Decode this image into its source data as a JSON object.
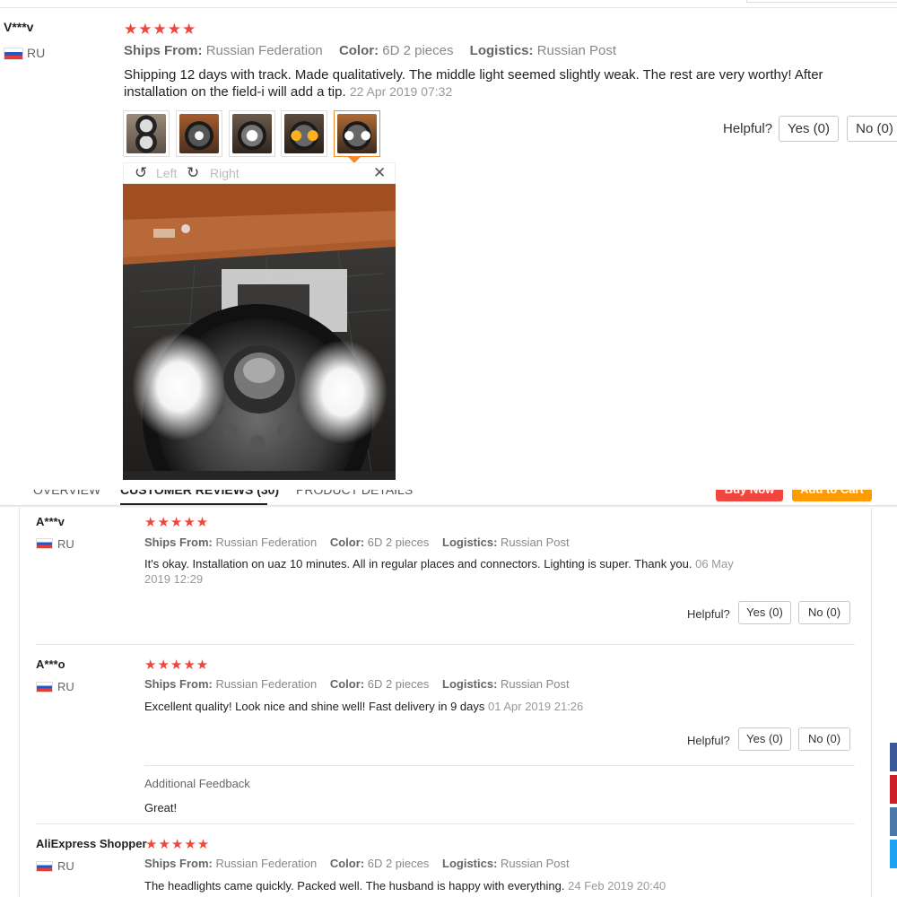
{
  "top_review": {
    "user": "V***v",
    "country": "RU",
    "stars": "★★★★★",
    "ships_from_label": "Ships From:",
    "ships_from": "Russian Federation",
    "color_label": "Color:",
    "color": "6D 2 pieces",
    "logistics_label": "Logistics:",
    "logistics": "Russian Post",
    "text": "Shipping 12 days with track. Made qualitatively. The middle light seemed slightly weak. The rest are very worthy! After installation on the field-i will add a tip.",
    "date": "22 Apr 2019 07:32",
    "helpful_label": "Helpful?",
    "yes_label": "Yes (0)",
    "no_label": "No (0)",
    "thumbnails": [
      "thumbnail-1",
      "thumbnail-2",
      "thumbnail-3",
      "thumbnail-4",
      "thumbnail-5"
    ],
    "selected_thumbnail": 5,
    "viewer": {
      "rotate_left_icon": "↺",
      "rotate_left_label": "Left",
      "rotate_right_icon": "↻",
      "rotate_right_label": "Right",
      "close_icon": "✕"
    }
  },
  "tabs": {
    "overview": "Overview",
    "reviews": "Customer Reviews (30)",
    "details": "Product Details",
    "buy_now": "Buy Now",
    "add_to_cart": "Add to Cart"
  },
  "reviews": [
    {
      "user": "A***v",
      "country": "RU",
      "stars": "★★★★★",
      "ships_from_label": "Ships From:",
      "ships_from": "Russian Federation",
      "color_label": "Color:",
      "color": "6D 2 pieces",
      "logistics_label": "Logistics:",
      "logistics": "Russian Post",
      "text": "It's okay. Installation on uaz 10 minutes. All in regular places and connectors. Lighting is super. Thank you.",
      "date": "06 May 2019 12:29",
      "helpful_label": "Helpful?",
      "yes_label": "Yes (0)",
      "no_label": "No (0)"
    },
    {
      "user": "A***o",
      "country": "RU",
      "stars": "★★★★★",
      "ships_from_label": "Ships From:",
      "ships_from": "Russian Federation",
      "color_label": "Color:",
      "color": "6D 2 pieces",
      "logistics_label": "Logistics:",
      "logistics": "Russian Post",
      "text": "Excellent quality! Look nice and shine well! Fast delivery in 9 days",
      "date": "01 Apr 2019 21:26",
      "helpful_label": "Helpful?",
      "yes_label": "Yes (0)",
      "no_label": "No (0)",
      "additional_feedback_label": "Additional Feedback",
      "additional_feedback": "Great!"
    },
    {
      "user": "AliExpress Shopper",
      "country": "RU",
      "stars": "★★★★★",
      "ships_from_label": "Ships From:",
      "ships_from": "Russian Federation",
      "color_label": "Color:",
      "color": "6D 2 pieces",
      "logistics_label": "Logistics:",
      "logistics": "Russian Post",
      "text": "The headlights came quickly. Packed well. The husband is happy with everything.",
      "date": "24 Feb 2019 20:40"
    }
  ],
  "social_colors": [
    "#3b5998",
    "#cb2027",
    "#4a76a8",
    "#1da1f2"
  ]
}
